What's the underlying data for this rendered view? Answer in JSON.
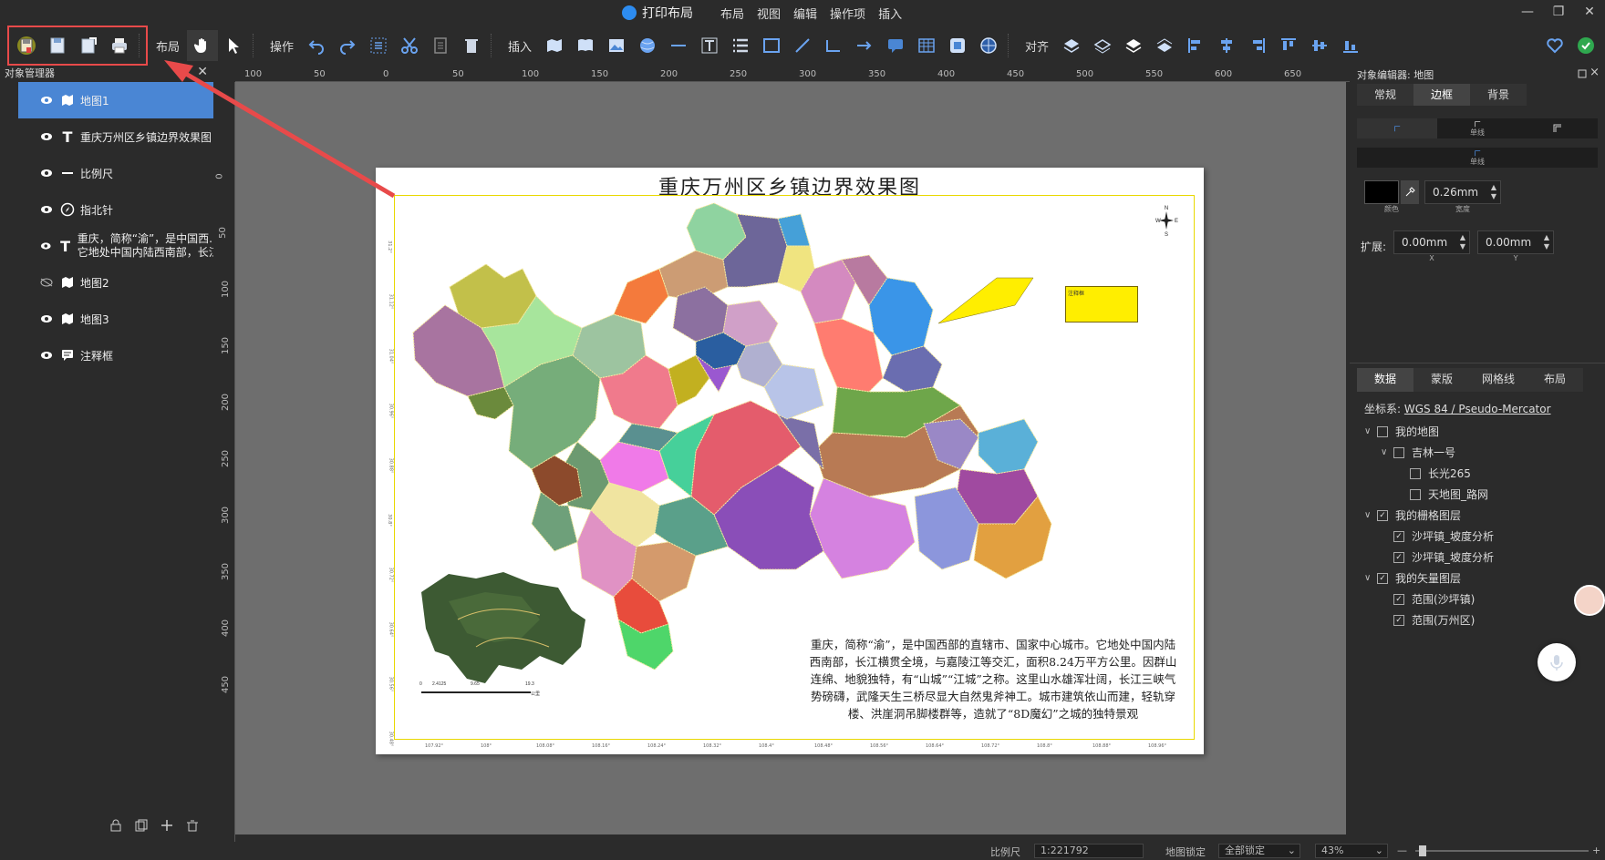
{
  "window": {
    "title": "打印布局",
    "menu": [
      "布局",
      "视图",
      "编辑",
      "操作项",
      "插入"
    ],
    "controls": {
      "minimize": "—",
      "restore": "❐",
      "close": "✕"
    }
  },
  "toolbar": {
    "layout_label": "布局",
    "operate_label": "操作",
    "insert_label": "插入",
    "align_label": "对齐"
  },
  "object_manager": {
    "header": "对象管理器",
    "close": "✕",
    "items": [
      {
        "type": "map",
        "label": "地图1",
        "visible": true,
        "active": true
      },
      {
        "type": "text",
        "label": "重庆万州区乡镇边界效果图",
        "visible": true
      },
      {
        "type": "scalebar",
        "label": "比例尺",
        "visible": true
      },
      {
        "type": "compass",
        "label": "指北针",
        "visible": true
      },
      {
        "type": "text",
        "label": "重庆，简称“渝”，是中国西...",
        "label2": "它地处中国内陆西南部，长江...",
        "visible": true
      },
      {
        "type": "map",
        "label": "地图2",
        "visible": false
      },
      {
        "type": "map",
        "label": "地图3",
        "visible": true
      },
      {
        "type": "callout",
        "label": "注释框",
        "visible": true
      }
    ]
  },
  "rulers": {
    "h": [
      "100",
      "50",
      "0",
      "50",
      "100",
      "150",
      "200",
      "250",
      "300",
      "350",
      "400",
      "450",
      "500",
      "550",
      "600",
      "650"
    ],
    "v": [
      "0",
      "50",
      "100",
      "150",
      "200",
      "250",
      "300",
      "350",
      "400",
      "450"
    ]
  },
  "page": {
    "title": "重庆万州区乡镇边界效果图",
    "callout_text": "注释框",
    "description": "重庆，简称“渝”，是中国西部的直辖市、国家中心城市。它地处中国内陆西南部，长江横贯全境，与嘉陵江等交汇，面积8.24万平方公里。因群山连绵、地貌独特，有“山城”“江城”之称。这里山水雄浑壮阔，长江三峡气势磅礴，武隆天生三桥尽显大自然鬼斧神工。城市建筑依山而建，轻轨穿楼、洪崖洞吊脚楼群等，造就了“8D魔幻”之城的独特景观",
    "lon_labels": [
      "107.92°",
      "108°",
      "108.08°",
      "108.16°",
      "108.24°",
      "108.32°",
      "108.4°",
      "108.48°",
      "108.56°",
      "108.64°",
      "108.72°",
      "108.8°",
      "108.88°",
      "108.96°"
    ],
    "lat_labels": [
      "31.2°",
      "31.12°",
      "31.04°",
      "30.96°",
      "30.88°",
      "30.8°",
      "30.72°",
      "30.64°",
      "30.56°",
      "30.48°"
    ],
    "scalebar_labels": [
      "0",
      "2.4125",
      "9.65",
      "19.3",
      "公里"
    ],
    "compass_letters": [
      "N",
      "W",
      "E",
      "S"
    ]
  },
  "object_editor": {
    "header": "对象编辑器: 地图",
    "tabs": [
      "常规",
      "边框",
      "背景"
    ],
    "active_tab": "边框",
    "line_label_1": "单线",
    "line_label_2": "单线",
    "color_label": "颜色",
    "width_value": "0.26mm",
    "width_label": "宽度",
    "expand_label": "扩展:",
    "expand_x": "0.00mm",
    "expand_y": "0.00mm",
    "x_label": "X",
    "y_label": "Y",
    "tabs2": [
      "数据",
      "蒙版",
      "网格线",
      "布局"
    ],
    "crs_label": "坐标系:",
    "crs_value": "WGS 84 / Pseudo-Mercator",
    "tree": [
      {
        "level": 0,
        "caret": "∨",
        "checked": false,
        "label": "我的地图"
      },
      {
        "level": 1,
        "caret": "∨",
        "checked": false,
        "label": "吉林一号"
      },
      {
        "level": 2,
        "caret": "",
        "checked": false,
        "label": "长光265"
      },
      {
        "level": 2,
        "caret": "",
        "checked": false,
        "label": "天地图_路网"
      },
      {
        "level": 0,
        "caret": "∨",
        "checked": true,
        "label": "我的栅格图层"
      },
      {
        "level": 1,
        "caret": "",
        "checked": true,
        "label": "沙坪镇_坡度分析"
      },
      {
        "level": 1,
        "caret": "",
        "checked": true,
        "label": "沙坪镇_坡度分析"
      },
      {
        "level": 0,
        "caret": "∨",
        "checked": true,
        "label": "我的矢量图层"
      },
      {
        "level": 1,
        "caret": "",
        "checked": true,
        "label": "范围(沙坪镇)"
      },
      {
        "level": 1,
        "caret": "",
        "checked": true,
        "label": "范围(万州区)"
      }
    ]
  },
  "status": {
    "scale_label": "比例尺",
    "scale_value": "1:221792",
    "lock_label": "地图锁定",
    "lock_value": "全部锁定",
    "zoom_value": "43%"
  },
  "colors": {
    "accent": "#4a86d4",
    "highlight": "#e84a4a",
    "callout": "#ffee00"
  }
}
